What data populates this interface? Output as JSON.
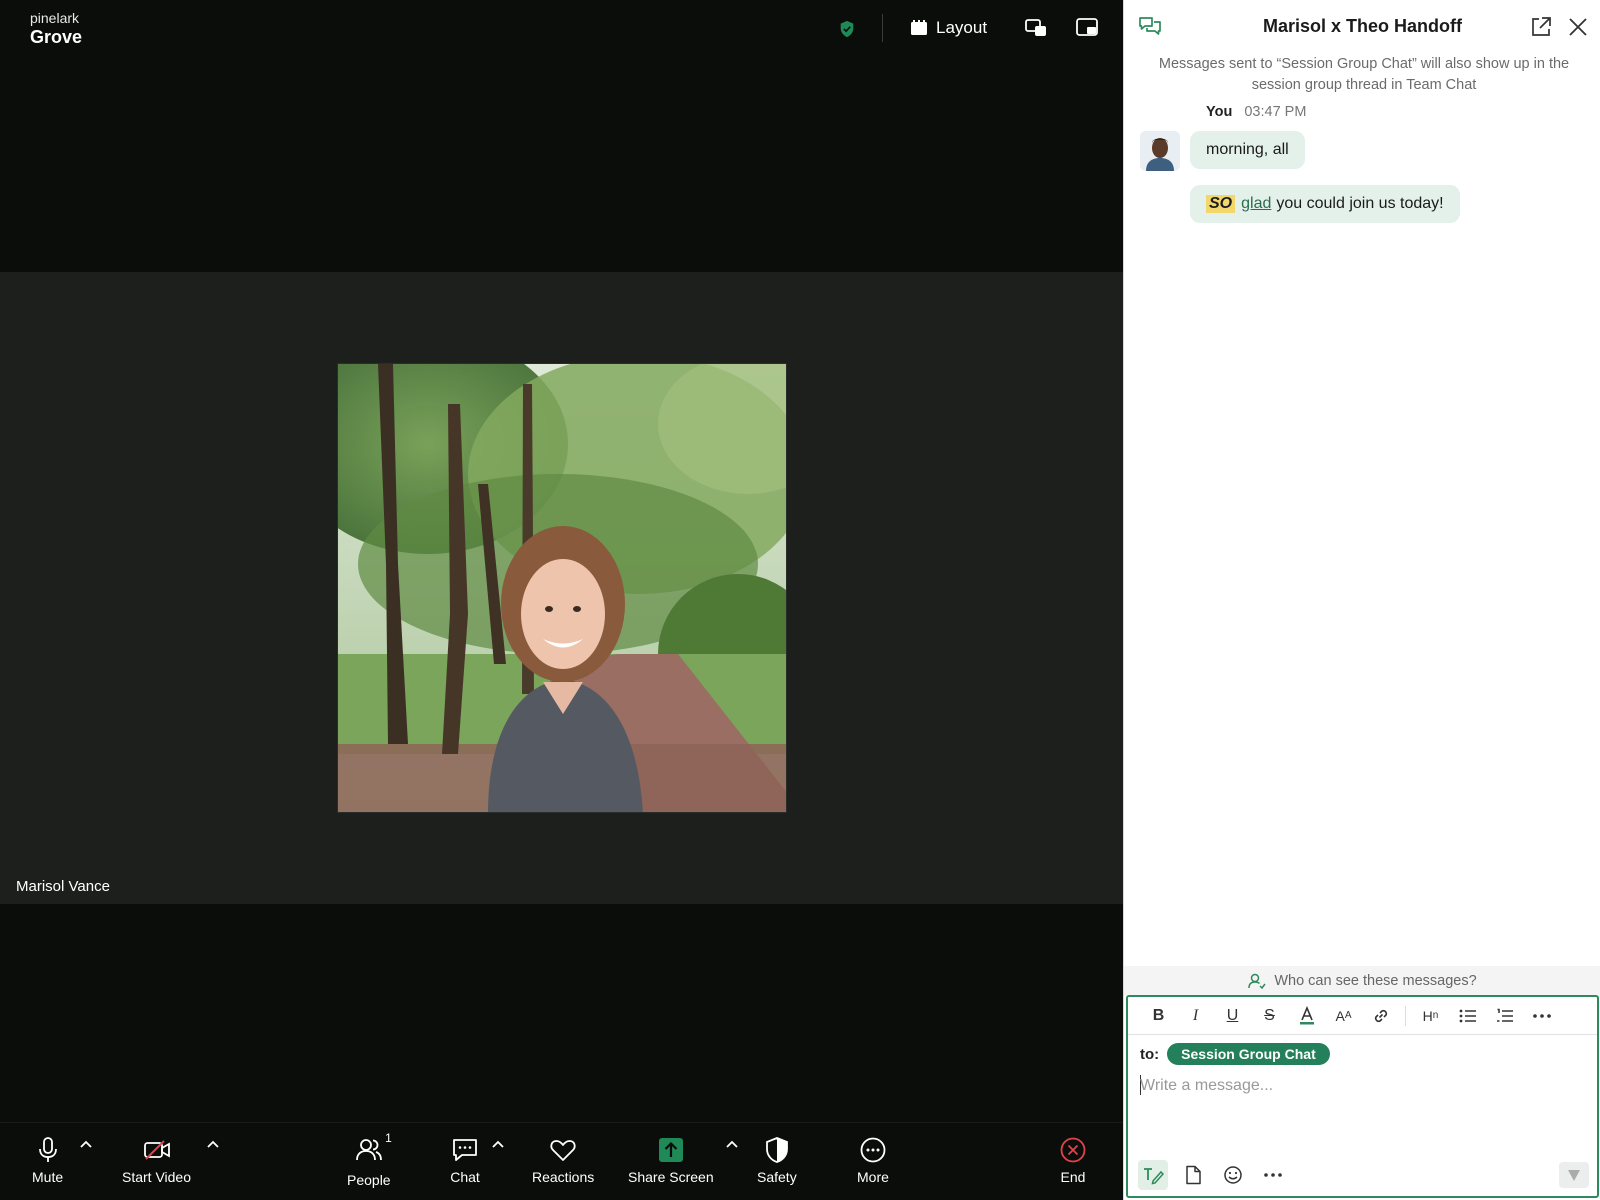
{
  "brand": {
    "org": "pinelark",
    "product": "Grove"
  },
  "topbar": {
    "layout_label": "Layout"
  },
  "stage": {
    "participant_name": "Marisol Vance"
  },
  "toolbar": {
    "mute": "Mute",
    "start_video": "Start Video",
    "people": "People",
    "people_count": "1",
    "chat": "Chat",
    "reactions": "Reactions",
    "share_screen": "Share Screen",
    "safety": "Safety",
    "more": "More",
    "end": "End"
  },
  "chat": {
    "title": "Marisol x Theo Handoff",
    "notice": "Messages sent to “Session Group Chat” will also show up in the session group thread in Team Chat",
    "messages": [
      {
        "sender": "You",
        "time": "03:47 PM",
        "text": "morning, all"
      },
      {
        "highlight": "SO",
        "underline": "glad",
        "rest": "you could join us today!"
      }
    ],
    "who_can_see": "Who can see these messages?",
    "to_label": "to:",
    "recipient": "Session Group Chat",
    "placeholder": "Write a message..."
  },
  "colors": {
    "accent": "#23805a",
    "bubble": "#e4f0ea",
    "end_red": "#e0434b",
    "share_green": "#1f8a57"
  }
}
